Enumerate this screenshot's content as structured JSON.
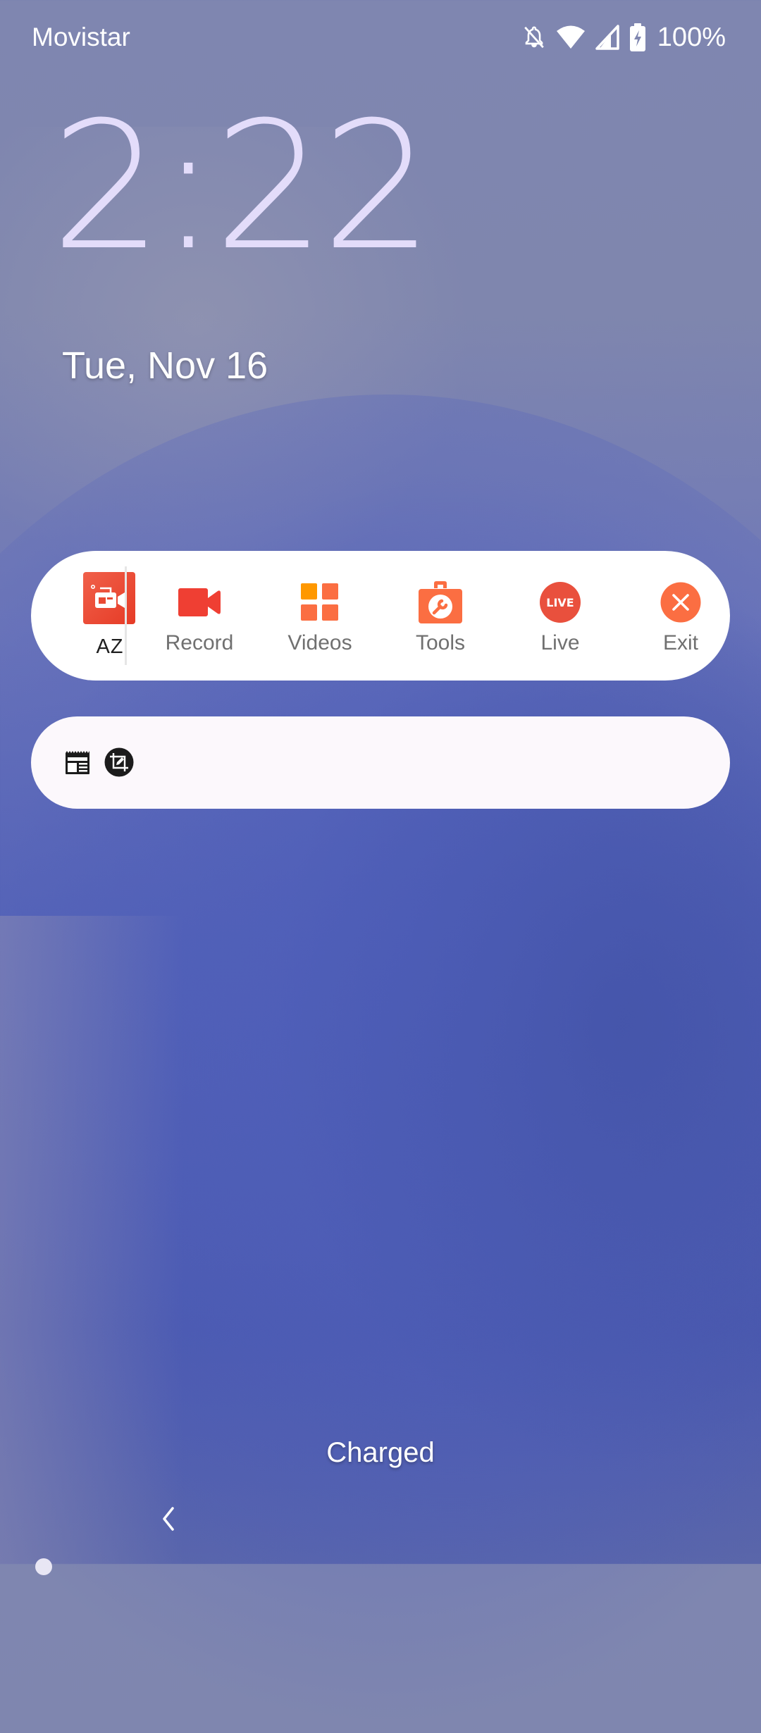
{
  "status_bar": {
    "carrier": "Movistar",
    "icons": [
      "notifications-off-icon",
      "wifi-icon",
      "cellular-signal-icon",
      "battery-charging-icon"
    ],
    "battery_percent": "100%"
  },
  "lockscreen": {
    "time": "2:22",
    "date": "Tue, Nov 16",
    "charging_status": "Charged"
  },
  "notification_main": {
    "app_name": "AZ",
    "app_icon": "az-recorder-camera-icon",
    "actions": [
      {
        "label": "Record",
        "icon": "video-camera-icon",
        "color": "#ef3f33"
      },
      {
        "label": "Videos",
        "icon": "grid-icon",
        "color": "#fb6e42"
      },
      {
        "label": "Tools",
        "icon": "toolbox-wrench-icon",
        "color": "#fb6e42"
      },
      {
        "label": "Live",
        "icon": "live-badge-icon",
        "icon_text": "LIVE",
        "color": "#e9503d"
      },
      {
        "label": "Exit",
        "icon": "close-circle-icon",
        "color": "#fb6e42"
      }
    ]
  },
  "notification_secondary": {
    "icons": [
      "newspaper-icon",
      "crop-edit-icon"
    ]
  },
  "navigation": {
    "back_icon": "chevron-left-icon"
  },
  "colors": {
    "brand_red": "#e63b26",
    "accent_orange": "#fb6e42",
    "accent_yellow": "#ff9800",
    "clock_color": "#e3dcfa"
  }
}
